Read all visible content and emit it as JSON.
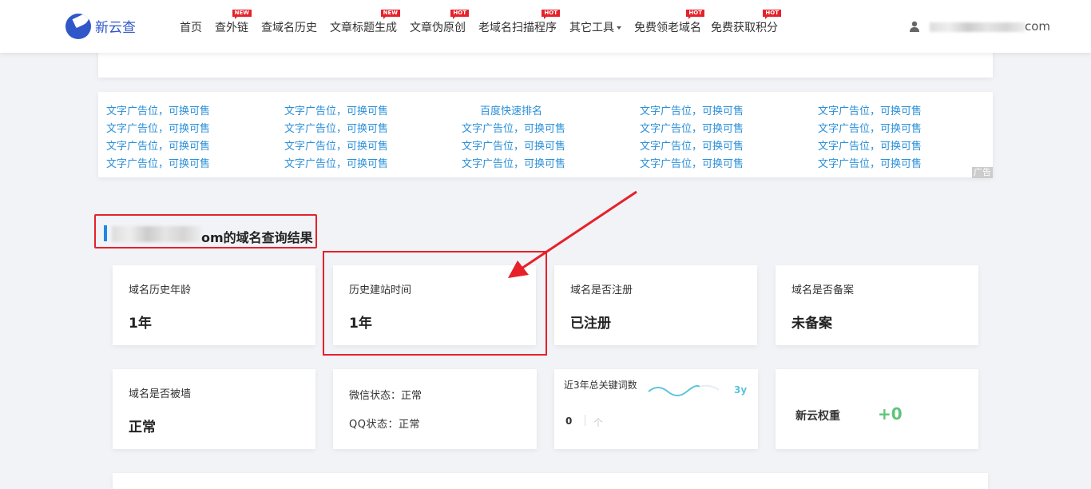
{
  "header": {
    "brand": "新云查",
    "nav": [
      {
        "label": "首页",
        "badge": ""
      },
      {
        "label": "查外链",
        "badge": "NEW"
      },
      {
        "label": "查域名历史",
        "badge": ""
      },
      {
        "label": "文章标题生成",
        "badge": "NEW"
      },
      {
        "label": "文章伪原创",
        "badge": "HOT"
      },
      {
        "label": "老域名扫描程序",
        "badge": "HOT"
      },
      {
        "label": "其它工具",
        "badge": ""
      },
      {
        "label": "免费领老域名",
        "badge": "HOT"
      },
      {
        "label": "免费获取积分",
        "badge": "HOT"
      }
    ],
    "user_suffix": "com"
  },
  "ads": {
    "text": "文字广告位，可换可售",
    "special": "百度快速排名",
    "tag": "广告"
  },
  "result": {
    "title_suffix": "om的域名查询结果"
  },
  "stats": [
    {
      "label": "域名历史年龄",
      "value": "1年"
    },
    {
      "label": "历史建站时间",
      "value": "1年"
    },
    {
      "label": "域名是否注册",
      "value": "已注册"
    },
    {
      "label": "域名是否备案",
      "value": "未备案"
    },
    {
      "label": "域名是否被墙",
      "value": "正常"
    }
  ],
  "wechat": {
    "label1": "微信状态：正常",
    "label2": "QQ状态：正常"
  },
  "keywords": {
    "label": "近3年总关键词数",
    "period": "3y",
    "count": "0",
    "unit": "个"
  },
  "weight": {
    "label": "新云权重",
    "value": "+0"
  }
}
